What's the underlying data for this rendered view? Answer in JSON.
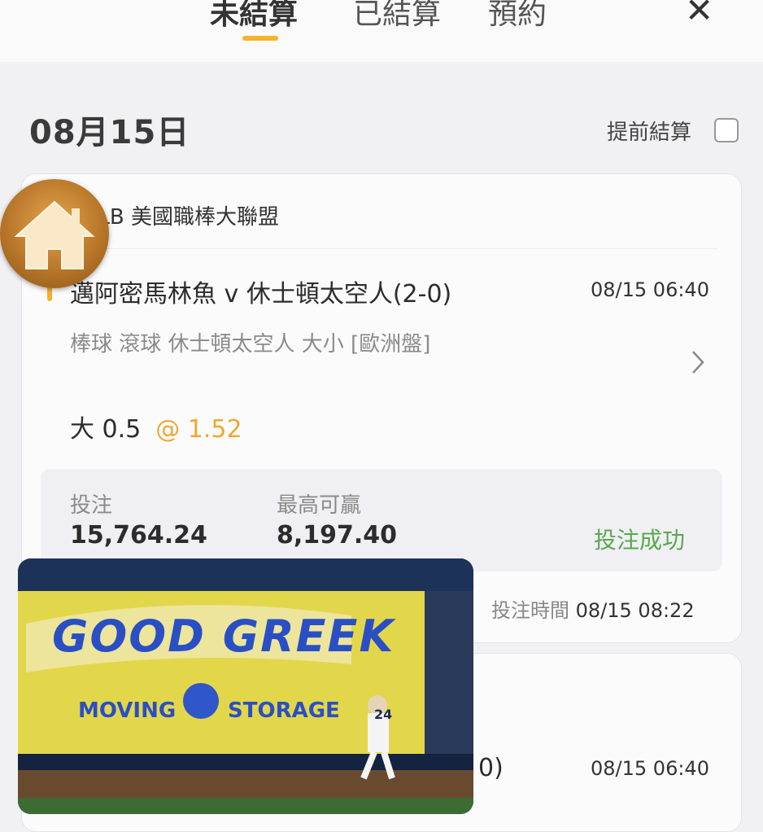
{
  "tabs": [
    {
      "label": "未結算",
      "active": true
    },
    {
      "label": "已結算",
      "active": false
    },
    {
      "label": "預約",
      "active": false
    }
  ],
  "header": {
    "close_glyph": "✕"
  },
  "date": "08月15日",
  "early_settle_label": "提前結算",
  "bets": [
    {
      "league": "MLB 美國職棒大聯盟",
      "match": "邁阿密馬林魚 v 休士頓太空人(2-0)",
      "match_time": "08/15 06:40",
      "market": "棒球 滾球   休士頓太空人 大小  [歐洲盤]",
      "selection": "大 0.5",
      "odds": "@ 1.52",
      "stake_label": "投注",
      "stake": "15,764.24",
      "max_win_label": "最高可贏",
      "max_win": "8,197.40",
      "status": "投注成功",
      "bet_time_label": "投注時間",
      "bet_time": "08/15 08:22"
    },
    {
      "match_partial": "0)",
      "match_time": "08/15 06:40"
    }
  ],
  "video": {
    "banner_title": "GOOD GREEK",
    "banner_left": "MOVING",
    "banner_right": "STORAGE",
    "jersey_number": "24"
  },
  "colors": {
    "accent": "#f4b32c",
    "success": "#5aa84c",
    "odds": "#f0a830"
  },
  "icons": {
    "home": "home-icon",
    "close": "close-icon",
    "chevron": "chevron-right-icon",
    "checkbox": "checkbox-icon"
  }
}
